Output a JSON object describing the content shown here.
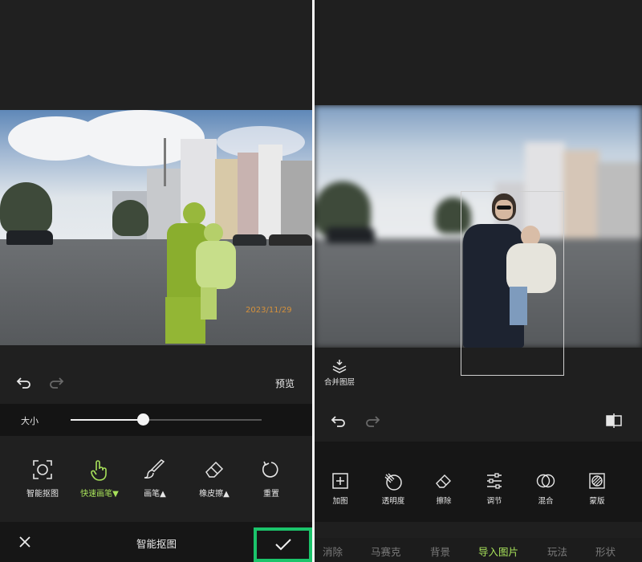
{
  "left": {
    "photo_watermark": "2023/11/29",
    "toolbar": {
      "preview_label": "预览"
    },
    "size_slider": {
      "label": "大小",
      "value_percent": 38
    },
    "tools": [
      {
        "label": "智能抠图",
        "icon": "smart-cutout-icon",
        "active": false
      },
      {
        "label": "快速画笔▼",
        "icon": "quick-brush-icon",
        "active": true
      },
      {
        "label": "画笔▲",
        "icon": "brush-icon",
        "active": false
      },
      {
        "label": "橡皮擦▲",
        "icon": "eraser-icon",
        "active": false
      },
      {
        "label": "重置",
        "icon": "reset-icon",
        "active": false
      }
    ],
    "footer": {
      "title": "智能抠图",
      "close_icon": "close-icon",
      "confirm_icon": "check-icon"
    }
  },
  "right": {
    "merge_layers_label": "合并图层",
    "tools": [
      {
        "label": "加图",
        "icon": "add-image-icon"
      },
      {
        "label": "透明度",
        "icon": "opacity-icon"
      },
      {
        "label": "擦除",
        "icon": "eraser-icon"
      },
      {
        "label": "调节",
        "icon": "adjust-icon"
      },
      {
        "label": "混合",
        "icon": "blend-icon"
      },
      {
        "label": "蒙版",
        "icon": "mask-icon"
      }
    ],
    "tabs": [
      {
        "label": "消除",
        "active": false
      },
      {
        "label": "马赛克",
        "active": false
      },
      {
        "label": "背景",
        "active": false
      },
      {
        "label": "导入图片",
        "active": true
      },
      {
        "label": "玩法",
        "active": false
      },
      {
        "label": "形状",
        "active": false
      }
    ]
  },
  "colors": {
    "accent_green": "#a7e15a",
    "confirm_green": "#1bc46b",
    "panel_bg": "#202020"
  }
}
